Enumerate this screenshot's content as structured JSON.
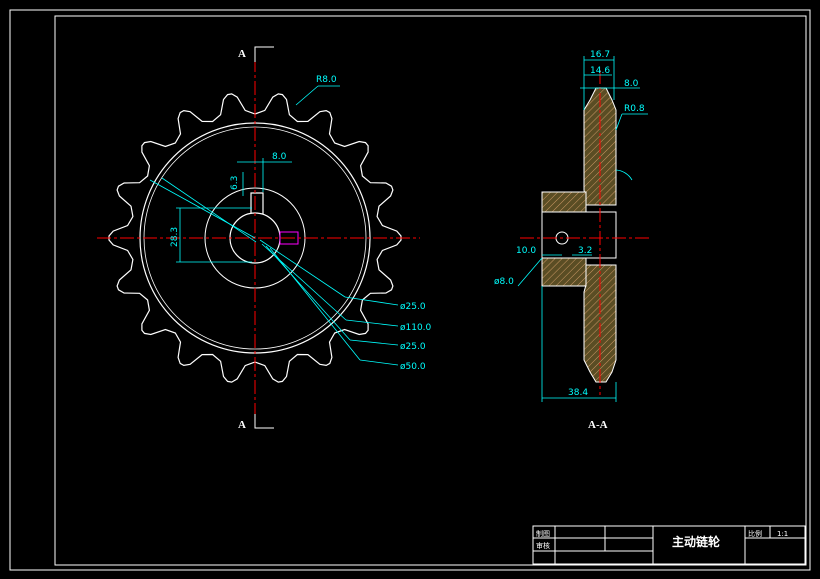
{
  "drawing": {
    "section_mark": "A",
    "section_view_label": "A-A",
    "front_view": {
      "tooth_count": 18,
      "dimensions": {
        "radius_root": "R8.0",
        "keyway_width": "8.0",
        "keyway_depth": "6.3",
        "keyway_height": "28.3",
        "dia_bore": "ø25.0",
        "dia_pitch": "ø110.0",
        "dia_hole": "ø25.0",
        "dia_hub": "ø50.0"
      }
    },
    "side_view": {
      "dimensions": {
        "width_top": "16.7",
        "width_mid": "14.6",
        "tooth_width": "8.0",
        "tip_radius": "R0.8",
        "pin_offset": "10.0",
        "pin_step": "3.2",
        "pin_dia": "ø8.0",
        "hub_length": "38.4"
      }
    }
  },
  "title_block": {
    "part_name": "主动链轮",
    "drawn_by_label": "制图",
    "checked_by_label": "审核",
    "scale_label": "比例",
    "scale_value": "1:1"
  },
  "colors": {
    "background": "#000000",
    "outline": "#ffffff",
    "centerline": "#ff0000",
    "dimension": "#00ffff",
    "hatch": "#cc9966",
    "hatch_fill": "#5a4d24",
    "keyway": "#ff00ff"
  }
}
